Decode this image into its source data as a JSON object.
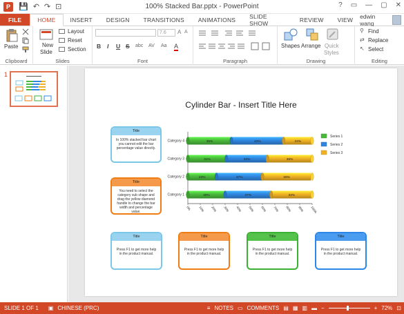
{
  "window": {
    "title": "100% Stacked Bar.pptx - PowerPoint",
    "app_icon_label": "P",
    "controls": [
      "?",
      "▭",
      "—",
      "▢",
      "✕"
    ]
  },
  "qat": {
    "save": "💾",
    "undo": "↶",
    "redo": "↷",
    "start": "⊡"
  },
  "tabs": [
    "FILE",
    "HOME",
    "INSERT",
    "DESIGN",
    "TRANSITIONS",
    "ANIMATIONS",
    "SLIDE SHOW",
    "REVIEW",
    "VIEW"
  ],
  "active_tab": "HOME",
  "user": {
    "name": "edwin wang"
  },
  "ribbon": {
    "clipboard": {
      "label": "Clipboard",
      "paste": "Paste"
    },
    "slides": {
      "label": "Slides",
      "new_slide": "New",
      "new_slide2": "Slide",
      "layout": "Layout",
      "reset": "Reset",
      "section": "Section"
    },
    "font": {
      "label": "Font",
      "size": "7.6",
      "bold": "B",
      "italic": "I",
      "underline": "U",
      "strike": "S",
      "shadow": "abc",
      "spacing": "AV",
      "case": "Aa",
      "color": "A"
    },
    "paragraph": {
      "label": "Paragraph"
    },
    "drawing": {
      "label": "Drawing",
      "shapes": "Shapes",
      "arrange": "Arrange",
      "quick": "Quick",
      "styles": "Styles"
    },
    "editing": {
      "label": "Editing",
      "find": "Find",
      "replace": "Replace",
      "select": "Select"
    }
  },
  "thumb_panel": {
    "slide_number": "1"
  },
  "slide": {
    "title": "Cylinder Bar - Insert Title Here",
    "callouts": [
      {
        "title": "Title",
        "body": "In 100% stacked bar chart you cannot edit the bar percentage value directly.",
        "color": "#7ac7e8"
      },
      {
        "title": "Title",
        "body": "You need to select the category sub shape and drag the yellow diamond handle to change the bar width and percentage value.",
        "color": "#f07c14"
      },
      {
        "title": "Title",
        "body": "Press F1 to get more help in the product manual.",
        "color": "#7ac7e8"
      },
      {
        "title": "Title",
        "body": "Press F1 to get more help in the product manual.",
        "color": "#f07c14"
      },
      {
        "title": "Title",
        "body": "Press F1 to get more help in the product manual.",
        "color": "#39b233"
      },
      {
        "title": "Title",
        "body": "Press F1 to get more help in the product manual.",
        "color": "#2c86e8"
      }
    ]
  },
  "chart_data": {
    "type": "bar",
    "orientation": "horizontal",
    "stacked": "100%",
    "categories": [
      "Category 4",
      "Category 3",
      "Category 2",
      "Category 1"
    ],
    "series": [
      {
        "name": "Series 1",
        "color": "#49b83b",
        "values": [
          35,
          31,
          23,
          30
        ],
        "labels": [
          "35%",
          "31%",
          "23%",
          "30%"
        ]
      },
      {
        "name": "Series 2",
        "color": "#2f86df",
        "values": [
          42,
          33,
          37,
          37
        ],
        "labels": [
          "42%",
          "33%",
          "37%",
          "37%"
        ]
      },
      {
        "name": "Series 3",
        "color": "#f0b125",
        "values": [
          23,
          36,
          39,
          33
        ],
        "labels": [
          "23%",
          "36%",
          "39%",
          "33%"
        ]
      }
    ],
    "xticks": [
      "0%",
      "10%",
      "20%",
      "30%",
      "40%",
      "50%",
      "60%",
      "70%",
      "80%",
      "90%",
      "100%"
    ],
    "xlim": [
      0,
      100
    ],
    "legend": "right"
  },
  "statusbar": {
    "slide": "SLIDE 1 OF 1",
    "language": "CHINESE (PRC)",
    "notes": "NOTES",
    "comments": "COMMENTS",
    "zoom": "72%"
  }
}
